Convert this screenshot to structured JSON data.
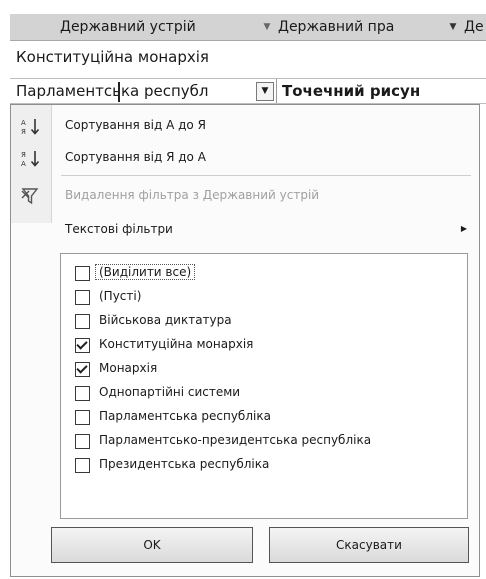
{
  "header": {
    "col1": "Державний устрій",
    "col2": "Державний пра",
    "col3": "Де"
  },
  "row2": {
    "value": "Конституційна монархія"
  },
  "row3": {
    "cell1": "Парламентська республ",
    "cell2": "Точечний рисун"
  },
  "menu": {
    "sort_asc": "Сортування від А до Я",
    "sort_desc": "Сортування від Я до А",
    "clear_filter": "Видалення фільтра з Державний устрій",
    "text_filters": "Текстові фільтри"
  },
  "list": [
    {
      "label": "(Виділити все)",
      "checked": false
    },
    {
      "label": "(Пусті)",
      "checked": false
    },
    {
      "label": "Військова диктатура",
      "checked": false
    },
    {
      "label": "Конституційна монархія",
      "checked": true
    },
    {
      "label": "Монархія",
      "checked": true
    },
    {
      "label": "Однопартійні системи",
      "checked": false
    },
    {
      "label": "Парламентська республіка",
      "checked": false
    },
    {
      "label": "Парламентсько-президентська республіка",
      "checked": false
    },
    {
      "label": "Президентська республіка",
      "checked": false
    }
  ],
  "buttons": {
    "ok": "OK",
    "cancel": "Скасувати"
  }
}
